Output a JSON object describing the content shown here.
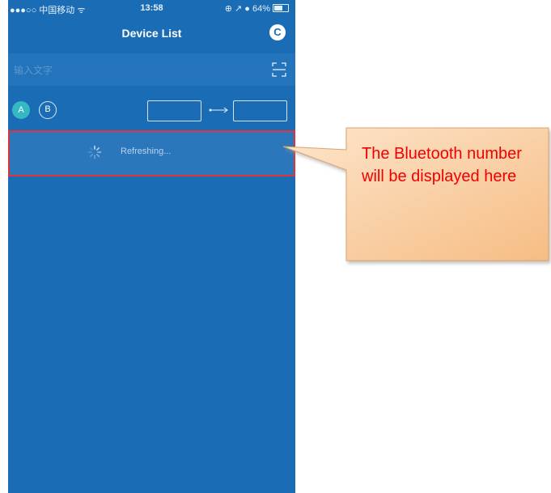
{
  "status_bar": {
    "carrier": "●●●○○ 中国移动 ᯤ",
    "time": "13:58",
    "battery": "⊕ ↗ ● 64%",
    "battery_level": 0.64
  },
  "nav": {
    "title": "Device List",
    "refresh_icon": "C"
  },
  "search": {
    "placeholder": "输入文字",
    "scan_icon": "scan-icon"
  },
  "toggles": {
    "a_label": "A",
    "b_label": "B"
  },
  "list": {
    "status_text": "Refreshing..."
  },
  "annotation": {
    "text": "The Bluetooth number will be displayed here"
  },
  "colors": {
    "app_background": "#1a6db5",
    "accent_teal": "#34b8c4",
    "highlight_border": "#e0333a",
    "callout_fill": "#f7c590",
    "callout_text": "#f20000"
  }
}
